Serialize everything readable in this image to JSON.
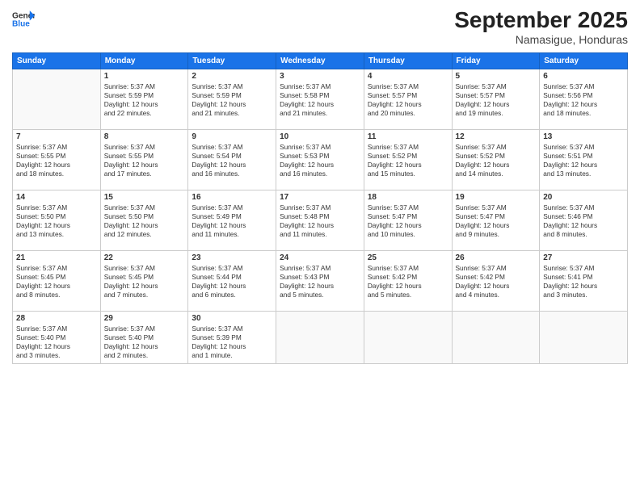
{
  "header": {
    "logo_line1": "General",
    "logo_line2": "Blue",
    "month": "September 2025",
    "location": "Namasigue, Honduras"
  },
  "days_of_week": [
    "Sunday",
    "Monday",
    "Tuesday",
    "Wednesday",
    "Thursday",
    "Friday",
    "Saturday"
  ],
  "weeks": [
    [
      {
        "day": "",
        "info": ""
      },
      {
        "day": "1",
        "info": "Sunrise: 5:37 AM\nSunset: 5:59 PM\nDaylight: 12 hours\nand 22 minutes."
      },
      {
        "day": "2",
        "info": "Sunrise: 5:37 AM\nSunset: 5:59 PM\nDaylight: 12 hours\nand 21 minutes."
      },
      {
        "day": "3",
        "info": "Sunrise: 5:37 AM\nSunset: 5:58 PM\nDaylight: 12 hours\nand 21 minutes."
      },
      {
        "day": "4",
        "info": "Sunrise: 5:37 AM\nSunset: 5:57 PM\nDaylight: 12 hours\nand 20 minutes."
      },
      {
        "day": "5",
        "info": "Sunrise: 5:37 AM\nSunset: 5:57 PM\nDaylight: 12 hours\nand 19 minutes."
      },
      {
        "day": "6",
        "info": "Sunrise: 5:37 AM\nSunset: 5:56 PM\nDaylight: 12 hours\nand 18 minutes."
      }
    ],
    [
      {
        "day": "7",
        "info": "Sunrise: 5:37 AM\nSunset: 5:55 PM\nDaylight: 12 hours\nand 18 minutes."
      },
      {
        "day": "8",
        "info": "Sunrise: 5:37 AM\nSunset: 5:55 PM\nDaylight: 12 hours\nand 17 minutes."
      },
      {
        "day": "9",
        "info": "Sunrise: 5:37 AM\nSunset: 5:54 PM\nDaylight: 12 hours\nand 16 minutes."
      },
      {
        "day": "10",
        "info": "Sunrise: 5:37 AM\nSunset: 5:53 PM\nDaylight: 12 hours\nand 16 minutes."
      },
      {
        "day": "11",
        "info": "Sunrise: 5:37 AM\nSunset: 5:52 PM\nDaylight: 12 hours\nand 15 minutes."
      },
      {
        "day": "12",
        "info": "Sunrise: 5:37 AM\nSunset: 5:52 PM\nDaylight: 12 hours\nand 14 minutes."
      },
      {
        "day": "13",
        "info": "Sunrise: 5:37 AM\nSunset: 5:51 PM\nDaylight: 12 hours\nand 13 minutes."
      }
    ],
    [
      {
        "day": "14",
        "info": "Sunrise: 5:37 AM\nSunset: 5:50 PM\nDaylight: 12 hours\nand 13 minutes."
      },
      {
        "day": "15",
        "info": "Sunrise: 5:37 AM\nSunset: 5:50 PM\nDaylight: 12 hours\nand 12 minutes."
      },
      {
        "day": "16",
        "info": "Sunrise: 5:37 AM\nSunset: 5:49 PM\nDaylight: 12 hours\nand 11 minutes."
      },
      {
        "day": "17",
        "info": "Sunrise: 5:37 AM\nSunset: 5:48 PM\nDaylight: 12 hours\nand 11 minutes."
      },
      {
        "day": "18",
        "info": "Sunrise: 5:37 AM\nSunset: 5:47 PM\nDaylight: 12 hours\nand 10 minutes."
      },
      {
        "day": "19",
        "info": "Sunrise: 5:37 AM\nSunset: 5:47 PM\nDaylight: 12 hours\nand 9 minutes."
      },
      {
        "day": "20",
        "info": "Sunrise: 5:37 AM\nSunset: 5:46 PM\nDaylight: 12 hours\nand 8 minutes."
      }
    ],
    [
      {
        "day": "21",
        "info": "Sunrise: 5:37 AM\nSunset: 5:45 PM\nDaylight: 12 hours\nand 8 minutes."
      },
      {
        "day": "22",
        "info": "Sunrise: 5:37 AM\nSunset: 5:45 PM\nDaylight: 12 hours\nand 7 minutes."
      },
      {
        "day": "23",
        "info": "Sunrise: 5:37 AM\nSunset: 5:44 PM\nDaylight: 12 hours\nand 6 minutes."
      },
      {
        "day": "24",
        "info": "Sunrise: 5:37 AM\nSunset: 5:43 PM\nDaylight: 12 hours\nand 5 minutes."
      },
      {
        "day": "25",
        "info": "Sunrise: 5:37 AM\nSunset: 5:42 PM\nDaylight: 12 hours\nand 5 minutes."
      },
      {
        "day": "26",
        "info": "Sunrise: 5:37 AM\nSunset: 5:42 PM\nDaylight: 12 hours\nand 4 minutes."
      },
      {
        "day": "27",
        "info": "Sunrise: 5:37 AM\nSunset: 5:41 PM\nDaylight: 12 hours\nand 3 minutes."
      }
    ],
    [
      {
        "day": "28",
        "info": "Sunrise: 5:37 AM\nSunset: 5:40 PM\nDaylight: 12 hours\nand 3 minutes."
      },
      {
        "day": "29",
        "info": "Sunrise: 5:37 AM\nSunset: 5:40 PM\nDaylight: 12 hours\nand 2 minutes."
      },
      {
        "day": "30",
        "info": "Sunrise: 5:37 AM\nSunset: 5:39 PM\nDaylight: 12 hours\nand 1 minute."
      },
      {
        "day": "",
        "info": ""
      },
      {
        "day": "",
        "info": ""
      },
      {
        "day": "",
        "info": ""
      },
      {
        "day": "",
        "info": ""
      }
    ]
  ]
}
